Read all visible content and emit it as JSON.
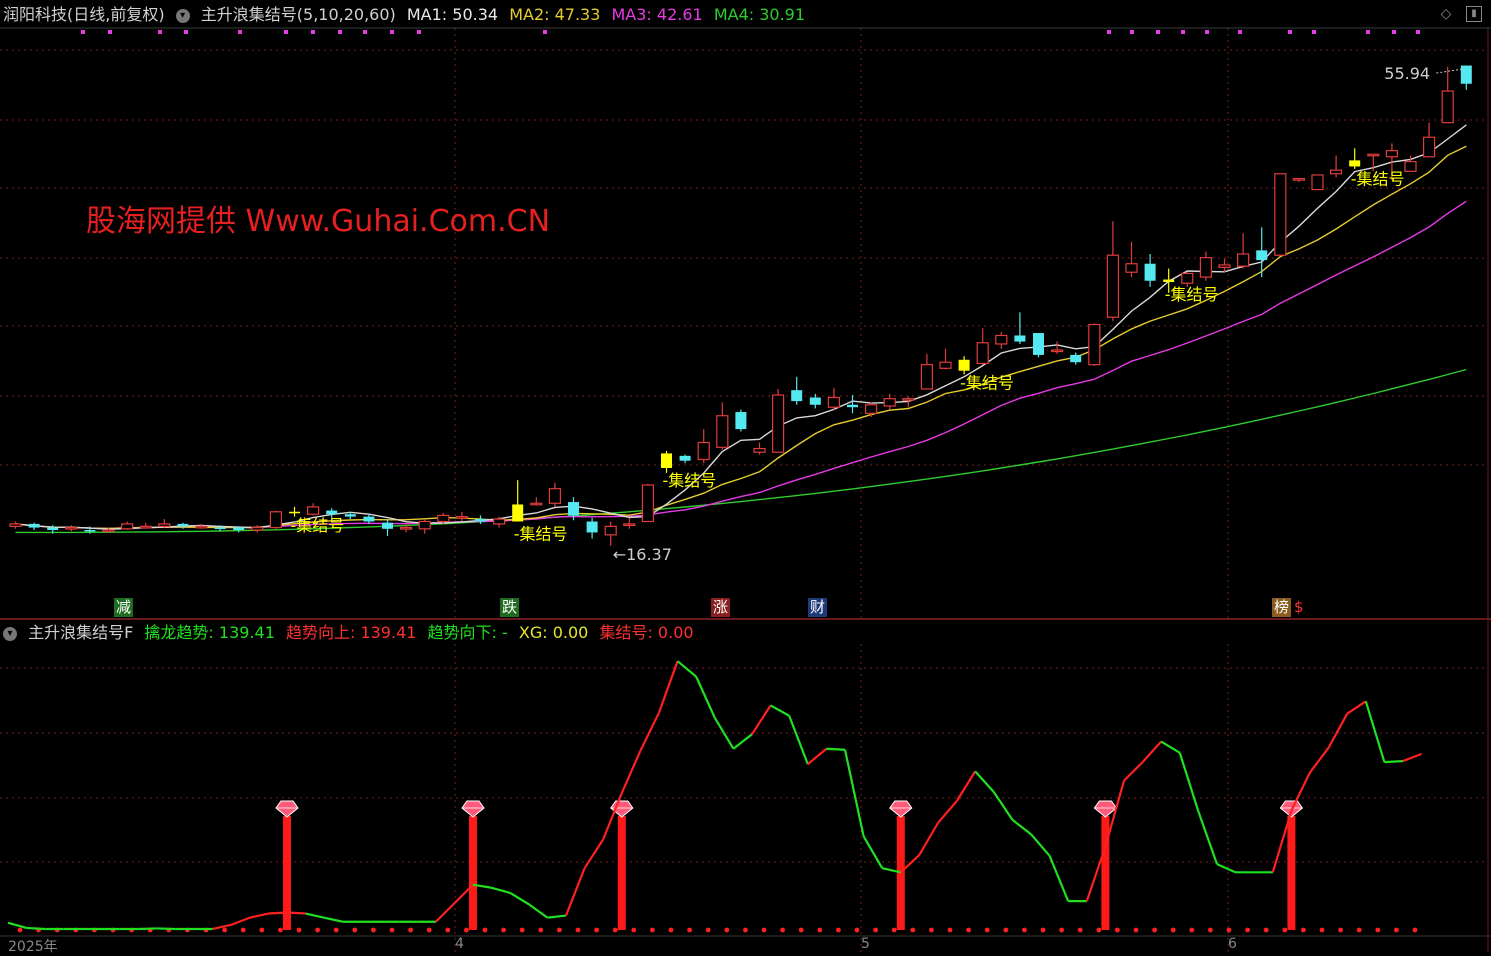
{
  "header": {
    "stock": "润阳科技(日线,前复权)",
    "indicator": "主升浪集结号(5,10,20,60)",
    "ma1": "MA1: 50.34",
    "ma2": "MA2: 47.33",
    "ma3": "MA3: 42.61",
    "ma4": "MA4: 30.91"
  },
  "sub_header": {
    "name": "主升浪集结号F",
    "qinglong": "擒龙趋势: 139.41",
    "up": "趋势向上: 139.41",
    "down": "趋势向下: -",
    "xg": "XG: 0.00",
    "jjh": "集结号: 0.00"
  },
  "watermark": "股海网提供 Www.Guhai.Com.CN",
  "colors": {
    "up": "#e03c3c",
    "down": "#54e8f0",
    "signal": "#ffff00",
    "ma1": "#d9d9d9",
    "ma2": "#e6cc2e",
    "ma3": "#e63ae6",
    "ma4": "#2ecc2e",
    "trend_up": "#ff2020",
    "trend_down": "#20e020",
    "grid": "#7a1f1f"
  },
  "tags": [
    {
      "text": "减",
      "bg": "#1f6b1f"
    },
    {
      "text": "跌",
      "bg": "#1f6b1f"
    },
    {
      "text": "涨",
      "bg": "#8a1f1f"
    },
    {
      "text": "财",
      "bg": "#1f3a7a"
    },
    {
      "text": "榜",
      "bg": "#8a5a1f"
    }
  ],
  "extra_tag": "$",
  "x_labels": [
    "2025年",
    "4",
    "5",
    "6"
  ],
  "chart_data": [
    {
      "type": "candlestick",
      "price_range": [
        14,
        58
      ],
      "max_label": "55.94",
      "min_label": "16.37",
      "series": [
        {
          "name": "MA1"
        },
        {
          "name": "MA2"
        },
        {
          "name": "MA3"
        },
        {
          "name": "MA4"
        }
      ],
      "candles": [
        [
          18.0,
          18.2,
          18.4,
          17.8
        ],
        [
          18.2,
          17.9,
          18.3,
          17.7
        ],
        [
          17.9,
          17.7,
          18.1,
          17.4
        ],
        [
          17.8,
          17.9,
          18.1,
          17.6
        ],
        [
          17.7,
          17.6,
          18.0,
          17.4
        ],
        [
          17.6,
          17.7,
          17.9,
          17.5
        ],
        [
          17.8,
          18.2,
          18.4,
          17.7
        ],
        [
          18.0,
          18.0,
          18.3,
          17.8
        ],
        [
          18.0,
          18.2,
          18.6,
          17.9
        ],
        [
          18.2,
          18.0,
          18.3,
          17.8
        ],
        [
          18.0,
          18.0,
          18.2,
          17.8
        ],
        [
          17.9,
          17.8,
          18.1,
          17.6
        ],
        [
          17.9,
          17.7,
          18.0,
          17.5
        ],
        [
          17.7,
          17.9,
          18.1,
          17.5
        ],
        [
          17.9,
          19.2,
          19.3,
          17.8
        ],
        [
          19.1,
          19.2,
          19.6,
          18.8
        ],
        [
          19.0,
          19.6,
          19.9,
          18.9
        ],
        [
          19.3,
          19.0,
          19.5,
          18.7
        ],
        [
          19.0,
          18.8,
          19.2,
          18.6
        ],
        [
          18.8,
          18.4,
          19.0,
          18.2
        ],
        [
          18.3,
          17.8,
          18.6,
          17.2
        ],
        [
          17.9,
          17.9,
          18.3,
          17.5
        ],
        [
          17.8,
          18.4,
          18.6,
          17.4
        ],
        [
          18.4,
          18.9,
          19.1,
          18.2
        ],
        [
          18.8,
          18.8,
          19.2,
          18.4
        ],
        [
          18.6,
          18.4,
          18.9,
          18.2
        ],
        [
          18.2,
          18.6,
          18.8,
          17.9
        ],
        [
          18.4,
          19.8,
          21.8,
          18.4
        ],
        [
          19.9,
          19.9,
          20.4,
          19.7
        ],
        [
          19.9,
          21.1,
          21.6,
          19.6
        ],
        [
          20.0,
          18.9,
          20.4,
          18.5
        ],
        [
          18.4,
          17.5,
          18.7,
          17.0
        ],
        [
          17.3,
          18.0,
          18.4,
          16.4
        ],
        [
          18.2,
          18.2,
          18.7,
          17.8
        ],
        [
          18.4,
          21.4,
          21.5,
          18.4
        ],
        [
          22.8,
          24.0,
          24.2,
          22.4
        ],
        [
          23.8,
          23.4,
          23.9,
          23.2
        ],
        [
          23.5,
          24.9,
          26.0,
          23.2
        ],
        [
          24.5,
          27.1,
          28.2,
          24.3
        ],
        [
          27.4,
          26.0,
          27.6,
          25.8
        ],
        [
          24.1,
          24.4,
          24.9,
          23.9
        ],
        [
          24.1,
          28.8,
          29.3,
          24.1
        ],
        [
          29.2,
          28.3,
          30.3,
          28.0
        ],
        [
          28.6,
          28.0,
          28.9,
          27.7
        ],
        [
          27.8,
          28.6,
          29.4,
          27.6
        ],
        [
          28.0,
          27.8,
          28.8,
          27.3
        ],
        [
          27.3,
          28.0,
          28.2,
          27.0
        ],
        [
          27.9,
          28.5,
          28.9,
          27.6
        ],
        [
          28.4,
          28.5,
          28.7,
          27.8
        ],
        [
          29.3,
          31.3,
          32.2,
          29.3
        ],
        [
          31.0,
          31.5,
          32.6,
          30.9
        ],
        [
          30.8,
          31.7,
          32.0,
          30.5
        ],
        [
          31.4,
          33.1,
          34.3,
          31.3
        ],
        [
          33.0,
          33.7,
          34.0,
          32.6
        ],
        [
          33.7,
          33.2,
          35.6,
          33.0
        ],
        [
          33.9,
          32.1,
          33.6,
          31.9
        ],
        [
          32.5,
          32.5,
          33.2,
          32.2
        ],
        [
          32.1,
          31.5,
          32.3,
          31.3
        ],
        [
          31.3,
          34.6,
          34.7,
          31.2
        ],
        [
          35.2,
          40.3,
          43.1,
          34.9
        ],
        [
          38.9,
          39.6,
          41.4,
          38.5
        ],
        [
          39.6,
          38.2,
          40.4,
          37.7
        ],
        [
          38.3,
          38.1,
          39.2,
          37.2
        ],
        [
          38.0,
          38.8,
          38.9,
          37.7
        ],
        [
          38.5,
          40.1,
          40.6,
          38.2
        ],
        [
          39.3,
          39.5,
          40.0,
          38.9
        ],
        [
          39.4,
          40.4,
          42.1,
          39.2
        ],
        [
          40.7,
          39.9,
          42.6,
          38.5
        ],
        [
          40.3,
          47.0,
          47.0,
          40.3
        ],
        [
          46.6,
          46.6,
          46.6,
          46.3
        ],
        [
          45.7,
          46.9,
          46.9,
          45.7
        ],
        [
          47.0,
          47.3,
          48.5,
          46.7
        ],
        [
          47.6,
          48.1,
          49.1,
          47.4
        ],
        [
          48.6,
          48.6,
          48.6,
          47.2
        ],
        [
          48.4,
          48.9,
          49.5,
          46.5
        ],
        [
          47.2,
          48.0,
          48.5,
          47.2
        ],
        [
          48.4,
          50.0,
          51.2,
          48.4
        ],
        [
          51.2,
          53.8,
          55.8,
          51.2
        ],
        [
          55.9,
          54.4,
          55.9,
          53.9
        ]
      ],
      "signals": [
        15,
        27,
        35,
        51,
        62,
        72
      ]
    },
    {
      "type": "line",
      "name": "擒龙趋势",
      "points": [
        [
          0,
          7.0,
          0
        ],
        [
          1,
          2.0,
          0
        ],
        [
          2,
          1.0,
          0
        ],
        [
          3,
          1.0,
          0
        ],
        [
          4,
          1.0,
          0
        ],
        [
          5,
          1.0,
          0
        ],
        [
          6,
          1.0,
          0
        ],
        [
          7,
          1.0,
          0
        ],
        [
          8,
          1.5,
          0
        ],
        [
          9,
          1.0,
          0
        ],
        [
          10,
          1.0,
          0
        ],
        [
          11,
          1.0,
          0
        ],
        [
          12,
          5.0,
          1
        ],
        [
          13,
          12.0,
          1
        ],
        [
          14,
          16.0,
          1
        ],
        [
          15,
          17.0,
          1
        ],
        [
          16,
          16.0,
          1
        ],
        [
          17,
          12.0,
          0
        ],
        [
          18,
          8.0,
          0
        ],
        [
          19,
          8.0,
          0
        ],
        [
          20,
          8.0,
          0
        ],
        [
          21,
          8.0,
          0
        ],
        [
          22,
          8.0,
          0
        ],
        [
          23,
          8.0,
          0
        ],
        [
          24,
          26.0,
          1
        ],
        [
          25,
          44.0,
          1
        ],
        [
          26,
          41.0,
          0
        ],
        [
          27,
          36.0,
          0
        ],
        [
          28,
          25.0,
          0
        ],
        [
          29,
          12.0,
          0
        ],
        [
          30,
          14.0,
          0
        ],
        [
          31,
          60.0,
          1
        ],
        [
          32,
          88.0,
          1
        ],
        [
          33,
          133.0,
          1
        ],
        [
          34,
          174.0,
          1
        ],
        [
          35,
          211.0,
          1
        ],
        [
          36,
          261.0,
          1
        ],
        [
          37,
          246.0,
          0
        ],
        [
          38,
          206.0,
          0
        ],
        [
          39,
          176.0,
          0
        ],
        [
          40,
          190.0,
          0
        ],
        [
          41,
          218.0,
          1
        ],
        [
          42,
          208.0,
          0
        ],
        [
          43,
          161.0,
          0
        ],
        [
          44,
          176.0,
          1
        ],
        [
          45,
          175.0,
          0
        ],
        [
          46,
          91.0,
          0
        ],
        [
          47,
          60.0,
          0
        ],
        [
          48,
          56.0,
          0
        ],
        [
          49,
          73.0,
          1
        ],
        [
          50,
          104.0,
          1
        ],
        [
          51,
          125.0,
          1
        ],
        [
          52,
          154.0,
          1
        ],
        [
          53,
          134.0,
          0
        ],
        [
          54,
          107.0,
          0
        ],
        [
          55,
          93.0,
          0
        ],
        [
          56,
          72.0,
          0
        ],
        [
          57,
          28.0,
          0
        ],
        [
          58,
          28.0,
          0
        ],
        [
          59,
          81.0,
          1
        ],
        [
          60,
          145.0,
          1
        ],
        [
          61,
          163.0,
          1
        ],
        [
          62,
          183.0,
          1
        ],
        [
          63,
          172.0,
          0
        ],
        [
          64,
          115.0,
          0
        ],
        [
          65,
          64.0,
          0
        ],
        [
          66,
          56.0,
          0
        ],
        [
          67,
          56.0,
          0
        ],
        [
          68,
          56.0,
          0
        ],
        [
          69,
          116.0,
          1
        ],
        [
          70,
          153.0,
          1
        ],
        [
          71,
          177.0,
          1
        ],
        [
          72,
          210.0,
          1
        ],
        [
          73,
          222.0,
          1
        ],
        [
          74,
          163.0,
          0
        ],
        [
          75,
          164.0,
          0
        ],
        [
          76,
          171.0,
          1
        ]
      ],
      "bars": [
        {
          "x": 15,
          "height": 114
        },
        {
          "x": 25,
          "height": 114
        },
        {
          "x": 33,
          "height": 114
        },
        {
          "x": 48,
          "height": 114
        },
        {
          "x": 59,
          "height": 114
        },
        {
          "x": 69,
          "height": 114
        }
      ]
    }
  ]
}
